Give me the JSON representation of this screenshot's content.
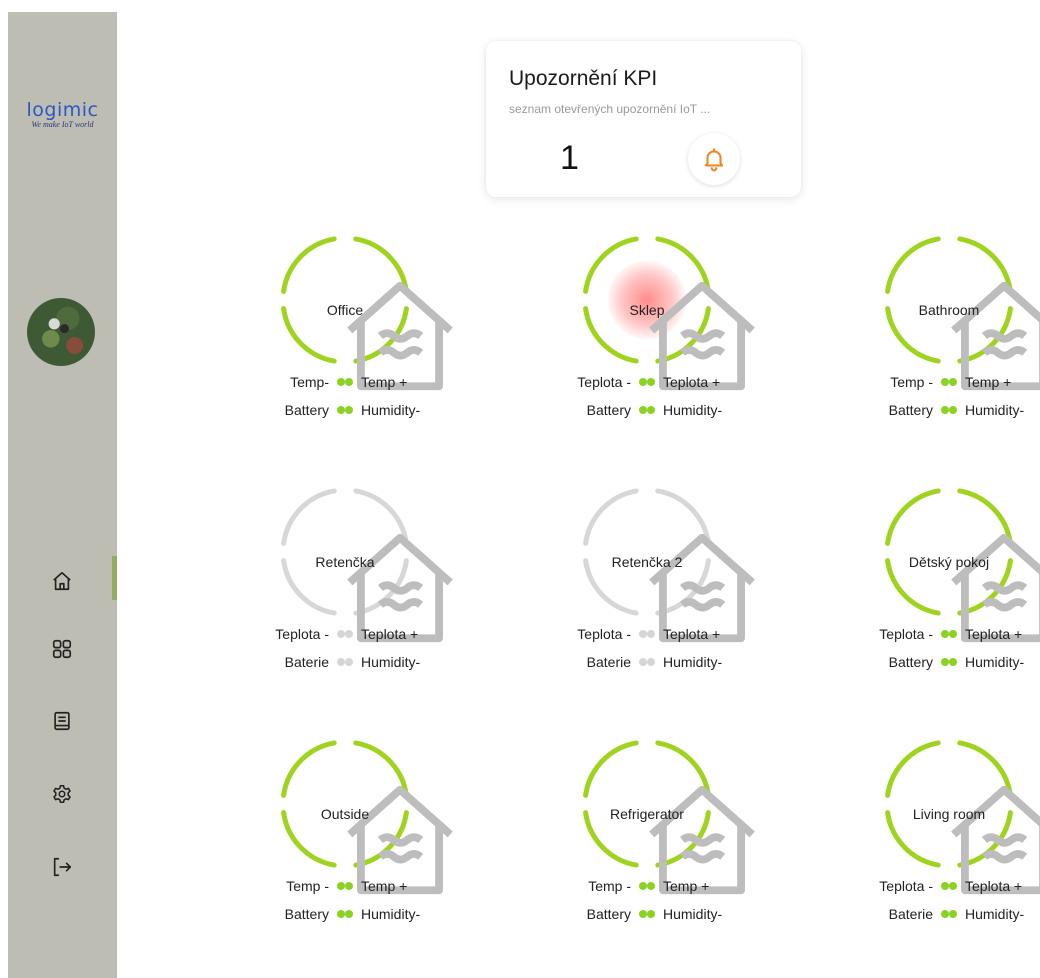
{
  "brand": {
    "name": "logimic",
    "tagline": "We make IoT world"
  },
  "kpi": {
    "title": "Upozornění KPI",
    "subtitle": "seznam otevřených upozornění IoT ...",
    "count": "1",
    "icon": "bell-icon",
    "accent_color": "#f5841f"
  },
  "nav": [
    {
      "icon": "home-icon",
      "active": true
    },
    {
      "icon": "grid-icon"
    },
    {
      "icon": "book-icon"
    },
    {
      "icon": "settings-icon"
    },
    {
      "icon": "logout-icon"
    }
  ],
  "colors": {
    "active": "#9ed31e",
    "inactive": "#d7d7d7",
    "alert": "#ff8080"
  },
  "rooms": [
    {
      "name": "Office",
      "status": "active",
      "alert": false,
      "indicators": {
        "tl": "Temp-",
        "tr": "Temp +",
        "bl": "Battery",
        "br": "Humidity-"
      }
    },
    {
      "name": "Sklep",
      "status": "active",
      "alert": true,
      "indicators": {
        "tl": "Teplota -",
        "tr": "Teplota +",
        "bl": "Battery",
        "br": "Humidity-"
      }
    },
    {
      "name": "Bathroom",
      "status": "active",
      "alert": false,
      "indicators": {
        "tl": "Temp -",
        "tr": "Temp +",
        "bl": "Battery",
        "br": "Humidity-"
      }
    },
    {
      "name": "Retenčka",
      "status": "inactive",
      "alert": false,
      "indicators": {
        "tl": "Teplota -",
        "tr": "Teplota +",
        "bl": "Baterie",
        "br": "Humidity-"
      }
    },
    {
      "name": "Retenčka 2",
      "status": "inactive",
      "alert": false,
      "indicators": {
        "tl": "Teplota -",
        "tr": "Teplota +",
        "bl": "Baterie",
        "br": "Humidity-"
      }
    },
    {
      "name": "Dětský pokoj",
      "status": "active",
      "alert": false,
      "indicators": {
        "tl": "Teplota -",
        "tr": "Teplota +",
        "bl": "Battery",
        "br": "Humidity-"
      }
    },
    {
      "name": "Outside",
      "status": "active",
      "alert": false,
      "indicators": {
        "tl": "Temp -",
        "tr": "Temp +",
        "bl": "Battery",
        "br": "Humidity-"
      }
    },
    {
      "name": "Refrigerator",
      "status": "active",
      "alert": false,
      "indicators": {
        "tl": "Temp -",
        "tr": "Temp +",
        "bl": "Battery",
        "br": "Humidity-"
      }
    },
    {
      "name": "Living room",
      "status": "active",
      "alert": false,
      "indicators": {
        "tl": "Teplota -",
        "tr": "Teplota +",
        "bl": "Baterie",
        "br": "Humidity-"
      }
    }
  ]
}
